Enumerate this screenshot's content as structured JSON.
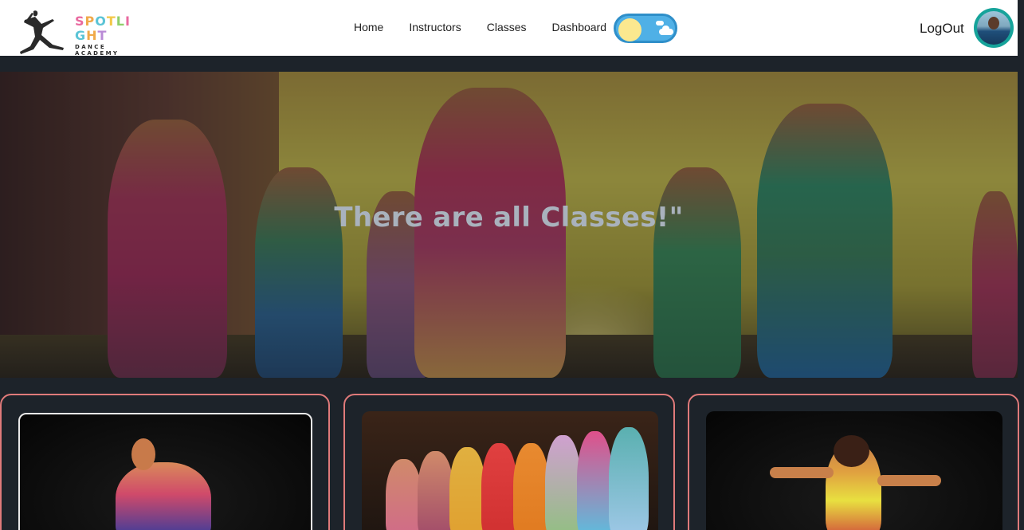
{
  "brand": {
    "name_letters": [
      "S",
      "P",
      "O",
      "T",
      "L",
      "I",
      "G",
      "H",
      "T"
    ],
    "name_colors": [
      "#e96aa0",
      "#f0a94a",
      "#5bc4d6",
      "#f3c84a",
      "#8fcf6a",
      "#e96aa0",
      "#5bc4d6",
      "#f0a94a",
      "#b98ad6"
    ],
    "subtitle": "DANCE ACADEMY"
  },
  "nav": {
    "links": [
      "Home",
      "Instructors",
      "Classes",
      "Dashboard"
    ],
    "logout_label": "LogOut",
    "theme_toggle": "light"
  },
  "hero": {
    "title": "There are all Classes!\""
  },
  "colors": {
    "page_bg": "#1d232a",
    "card_border": "#e07a7a",
    "toggle_bg": "#4fb0e6",
    "hero_text": "#a9b2bd"
  }
}
